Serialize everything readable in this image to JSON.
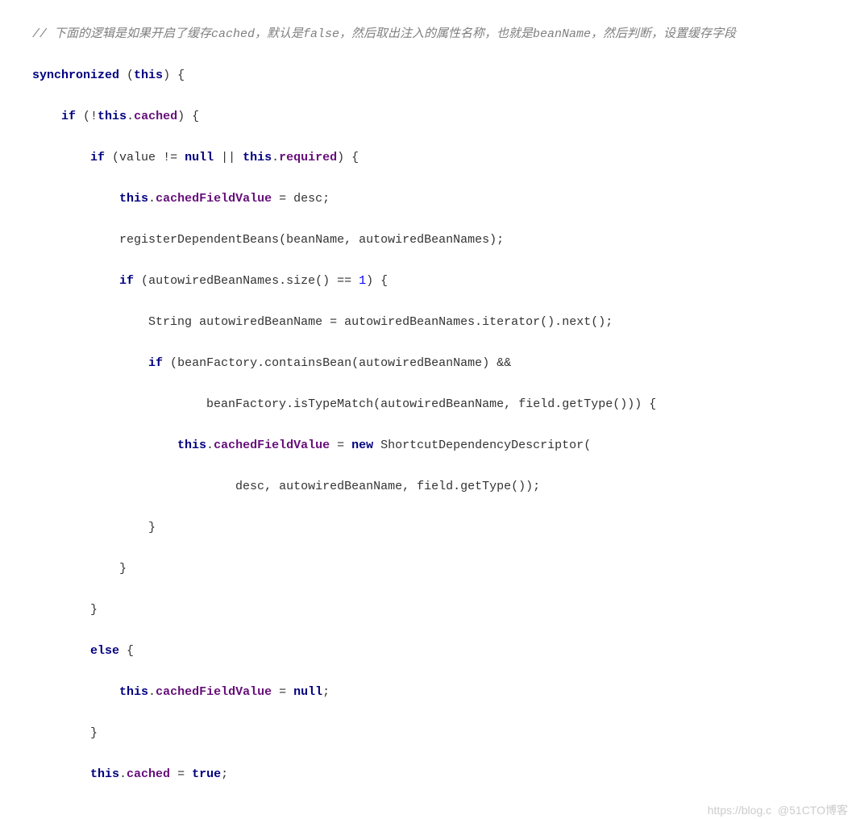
{
  "code": {
    "comment": "// 下面的逻辑是如果开启了缓存cached，默认是false，然后取出注入的属性名称，也就是beanName，然后判断，设置缓存字段",
    "kw_synchronized": "synchronized",
    "kw_this": "this",
    "kw_if": "if",
    "kw_else": "else",
    "kw_null": "null",
    "kw_new": "new",
    "kw_true": "true",
    "field_cached": "cached",
    "field_required": "required",
    "field_cachedFieldValue": "cachedFieldValue",
    "ident_value": "value",
    "ident_desc": "desc",
    "fn_registerDependentBeans": "registerDependentBeans",
    "ident_beanName": "beanName",
    "ident_autowiredBeanNames": "autowiredBeanNames",
    "fn_size": "size",
    "num_one": "1",
    "type_String": "String",
    "ident_autowiredBeanName": "autowiredBeanName",
    "fn_iterator": "iterator",
    "fn_next": "next",
    "ident_beanFactory": "beanFactory",
    "fn_containsBean": "containsBean",
    "fn_isTypeMatch": "isTypeMatch",
    "ident_field": "field",
    "fn_getType": "getType",
    "type_ShortcutDependencyDescriptor": "ShortcutDependencyDescriptor",
    "watermark": "https://blog.c  @51CTO博客"
  }
}
